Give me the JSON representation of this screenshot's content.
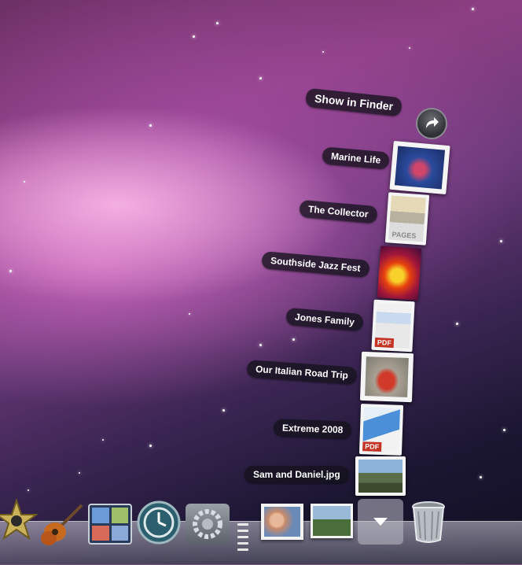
{
  "stack": {
    "show_in_finder": "Show in Finder",
    "items": [
      {
        "label": "Marine Life"
      },
      {
        "label": "The Collector"
      },
      {
        "label": "Southside Jazz Fest"
      },
      {
        "label": "Jones Family"
      },
      {
        "label": "Our Italian Road Trip"
      },
      {
        "label": "Extreme 2008"
      },
      {
        "label": "Sam and Daniel.jpg"
      }
    ]
  },
  "dock": {
    "items": [
      {
        "icon": "imovie-star-icon"
      },
      {
        "icon": "garageband-guitar-icon"
      },
      {
        "icon": "spaces-icon"
      },
      {
        "icon": "time-machine-icon"
      },
      {
        "icon": "system-preferences-icon"
      },
      {
        "icon": "photos-stack-icon"
      },
      {
        "icon": "photo-stack-icon"
      },
      {
        "icon": "downloads-stack-icon"
      },
      {
        "icon": "trash-icon"
      }
    ]
  }
}
